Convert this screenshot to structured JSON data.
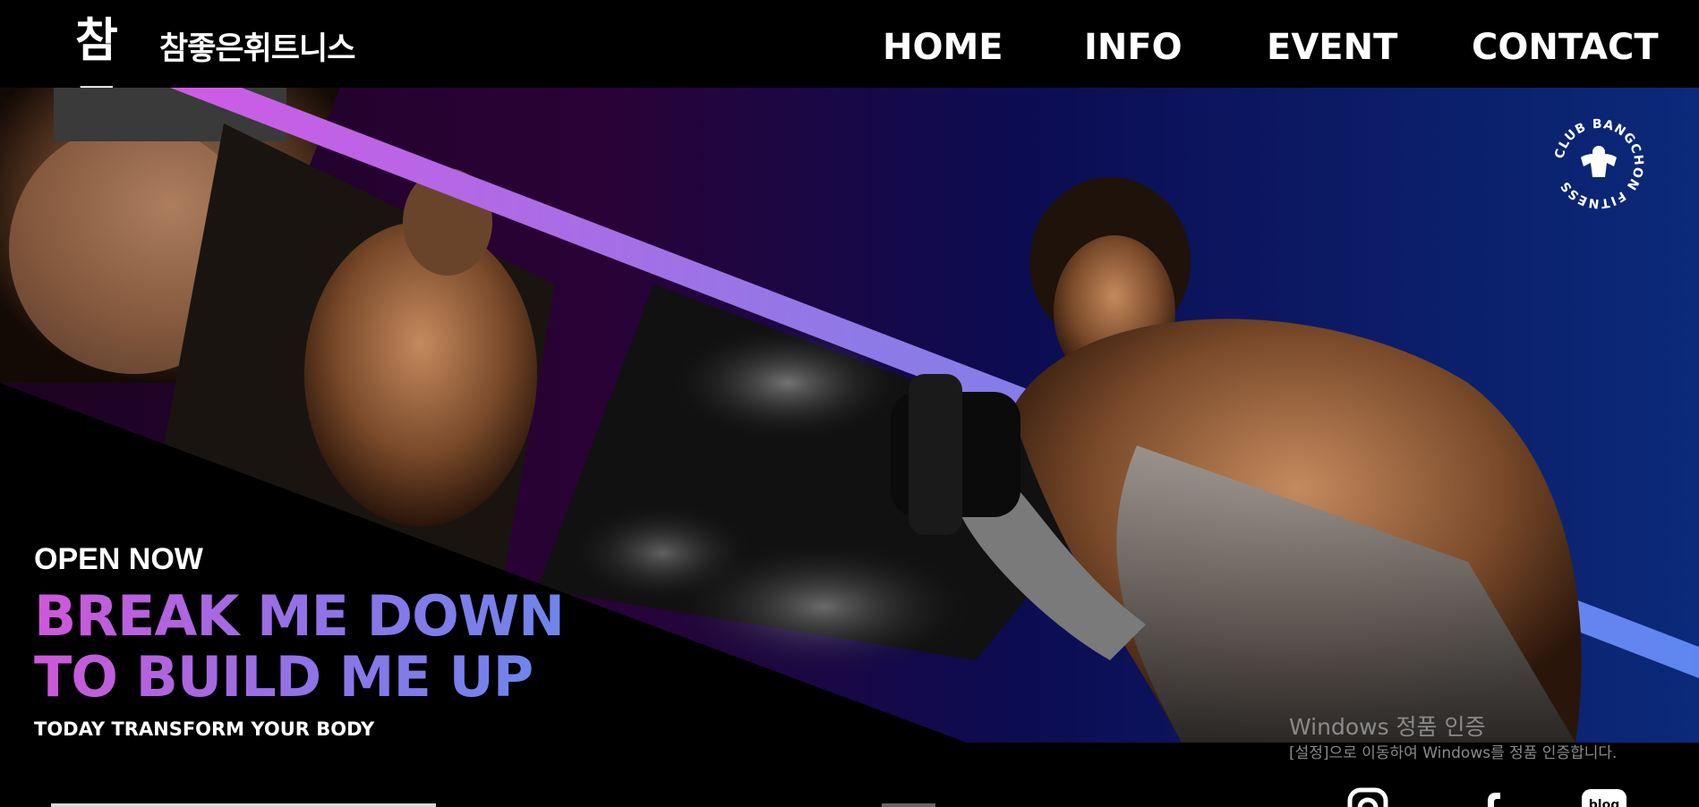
{
  "header": {
    "logo_mark": "참좋",
    "logo_text": "참좋은휘트니스",
    "nav": [
      {
        "label": "HOME"
      },
      {
        "label": "INFO"
      },
      {
        "label": "EVENT"
      },
      {
        "label": "CONTACT"
      }
    ]
  },
  "hero": {
    "open_now": "OPEN NOW",
    "headline_line1": "BREAK ME DOWN",
    "headline_line2": "TO BUILD ME UP",
    "subline": "TODAY TRANSFORM YOUR BODY",
    "badge_text": "CLUB BANGCHON FITNESS",
    "badge_icon": "bodybuilder-icon",
    "accent_colors": [
      "#cf57d9",
      "#8f73e6",
      "#6e86ec"
    ]
  },
  "watermark": {
    "title": "Windows 정품 인증",
    "subtitle": "[설정]으로 이동하여 Windows를 정품 인증합니다."
  },
  "social": {
    "instagram_icon": "instagram-icon",
    "facebook_icon": "facebook-icon",
    "blog_icon": "blog-icon",
    "blog_label": "blog"
  }
}
